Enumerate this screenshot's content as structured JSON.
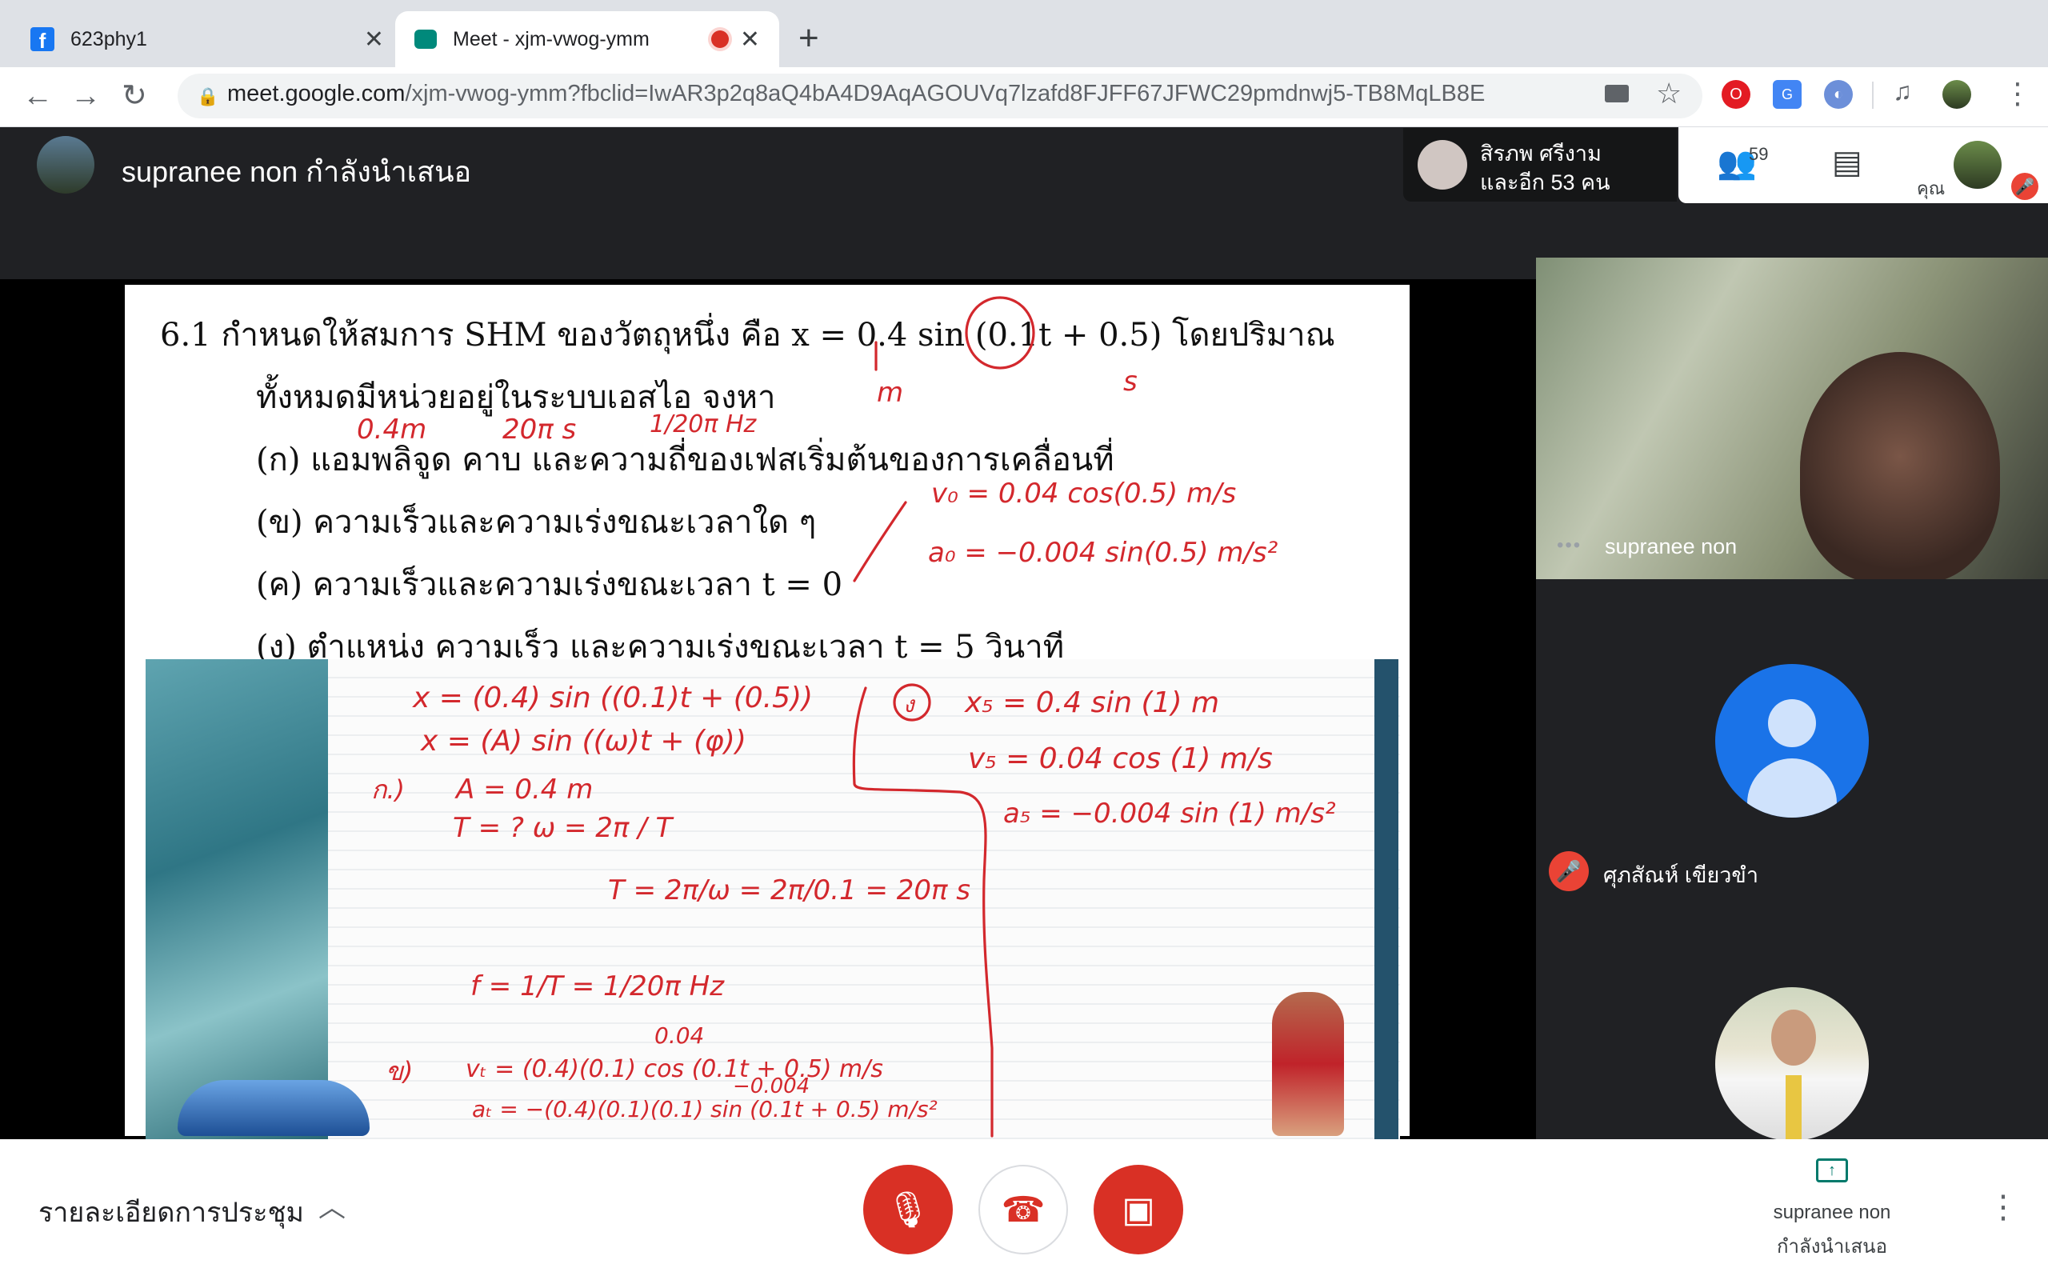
{
  "browser": {
    "tabs": [
      {
        "title": "623phy1",
        "icon": "facebook-icon",
        "active": false
      },
      {
        "title": "Meet - xjm-vwog-ymm",
        "icon": "meet-icon",
        "active": true,
        "recording": true
      }
    ],
    "url_host": "meet.google.com",
    "url_path": "/xjm-vwog-ymm?fbclid=IwAR3p2q8aQ4bA4D9AqAGOUVq7lzafd8FJFF67JFWC29pmdnwj5-TB8MqLB8E"
  },
  "meet": {
    "presenter_title": "supranee non กำลังนำเสนอ",
    "participants_chip": {
      "line1": "สิรภพ ศรีงาม",
      "line2": "และอีก 53 คน"
    },
    "people_count": "59",
    "you_label": "คุณ",
    "tiles": [
      {
        "name": "supranee non"
      },
      {
        "name": "ศุภสัณห์ เขียวขำ",
        "muted": true
      }
    ],
    "bottom": {
      "details_label": "รายละเอียดการประชุม",
      "present_line1": "supranee non",
      "present_line2": "กำลังนำเสนอ"
    }
  },
  "slide": {
    "lines": [
      "6.1   กำหนดให้สมการ SHM ของวัตถุหนึ่ง คือ x = 0.4 sin (0.1t + 0.5) โดยปริมาณ",
      "ทั้งหมดมีหน่วยอยู่ในระบบเอสไอ จงหา",
      "(ก) แอมพลิจูด คาบ และความถี่ของเฟสเริ่มต้นของการเคลื่อนที่",
      "(ข) ความเร็วและความเร่งขณะเวลาใด ๆ",
      "(ค) ความเร็วและความเร่งขณะเวลา t = 0",
      "(ง) ตำแหน่ง ความเร็ว และความเร่งขณะเวลา t = 5 วินาที"
    ],
    "annotations": {
      "m": "m",
      "s": "s",
      "amp": "0.4m",
      "period": "20π s",
      "freq": "1/20π Hz",
      "v0": "v₀ = 0.04 cos(0.5) m/s",
      "a0": "a₀ = −0.004 sin(0.5) m/s²"
    },
    "whiteboard": {
      "eq1": "x = (0.4) sin ((0.1)t + (0.5))",
      "eq2": "x = (A) sin ((ω)t + (φ))",
      "k": "ก.)",
      "A": "A = 0.4  m",
      "T": "T = ?   ω = 2π / T",
      "T2": "T = 2π/ω = 2π/0.1 = 20π s",
      "f": "f = 1/T = 1/20π  Hz",
      "kh": "ข)",
      "vt_top": "0.04",
      "vt": "vₜ = (0.4)(0.1) cos (0.1t + 0.5)  m/s",
      "at_top": "−0.004",
      "at": "aₜ = −(0.4)(0.1)(0.1) sin (0.1t + 0.5)  m/s²",
      "ng": "ง",
      "x5": "x₅ = 0.4 sin (1)  m",
      "v5": "v₅ = 0.04 cos (1)  m/s",
      "a5": "a₅ = −0.004 sin (1)  m/s²"
    }
  },
  "colors": {
    "accent_red": "#d93025",
    "meet_dark": "#202124",
    "ink_red": "#d3282d",
    "avatar_blue": "#1a73e8"
  }
}
